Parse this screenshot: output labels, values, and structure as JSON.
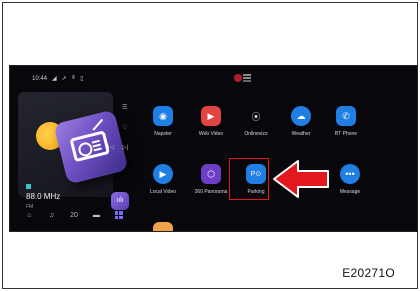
{
  "status_bar": {
    "time": "10:44"
  },
  "media": {
    "frequency": "88.0 MHz",
    "band": "FM"
  },
  "apps": {
    "row1": [
      {
        "label": "Napster",
        "icon": "napster-icon",
        "color": "#1f7fe3"
      },
      {
        "label": "Web Video",
        "icon": "play-icon",
        "color": "#e24343"
      },
      {
        "label": "Onlinevizo",
        "icon": "wifi-voice-icon",
        "color": "#101010"
      },
      {
        "label": "Weather",
        "icon": "cloud-icon",
        "color": "#1f7fe3"
      },
      {
        "label": "BT Phone",
        "icon": "phone-icon",
        "color": "#1f7fe3"
      }
    ],
    "row2": [
      {
        "label": "Local Video",
        "icon": "play-icon",
        "color": "#1f7fe3"
      },
      {
        "label": "360 Panorama",
        "icon": "panorama-icon",
        "color": "#6f3ec6"
      },
      {
        "label": "Parking",
        "icon": "parking-icon",
        "color": "#1f7fe3"
      },
      {
        "label": "Message",
        "icon": "message-icon",
        "color": "#1f7fe3"
      }
    ]
  },
  "figure_code": "E20271O",
  "highlight_color": "#e3171e"
}
